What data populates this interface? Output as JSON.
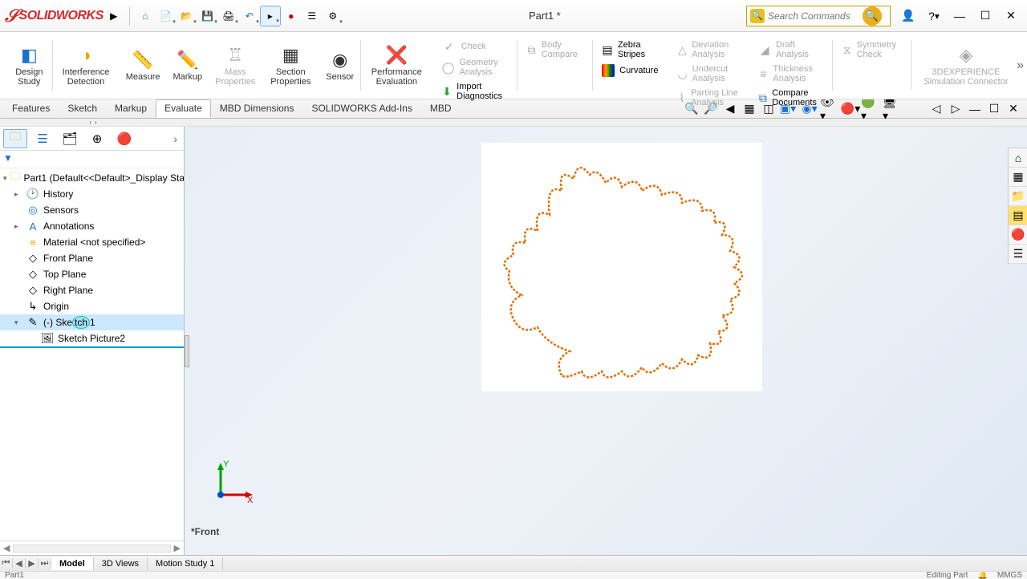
{
  "title": "Part1 *",
  "search_placeholder": "Search Commands",
  "quick_access": [
    "home",
    "new",
    "open",
    "save",
    "print",
    "undo",
    "select",
    "rec",
    "options",
    "gear"
  ],
  "ribbon": {
    "design_study": "Design Study",
    "interference": "Interference Detection",
    "measure": "Measure",
    "markup": "Markup",
    "mass_props": "Mass Properties",
    "section_props": "Section Properties",
    "sensor": "Sensor",
    "perf_eval": "Performance Evaluation",
    "check": "Check",
    "geom_analysis": "Geometry Analysis",
    "import_diag": "Import Diagnostics",
    "body_compare": "Body Compare",
    "zebra": "Zebra Stripes",
    "curvature": "Curvature",
    "deviation": "Deviation Analysis",
    "undercut": "Undercut Analysis",
    "parting": "Parting Line Analysis",
    "draft": "Draft Analysis",
    "thickness": "Thickness Analysis",
    "compare_docs": "Compare Documents",
    "symmetry": "Symmetry Check",
    "exp_sim": "3DEXPERIENCE Simulation Connector"
  },
  "tabs": [
    "Features",
    "Sketch",
    "Markup",
    "Evaluate",
    "MBD Dimensions",
    "SOLIDWORKS Add-Ins",
    "MBD"
  ],
  "active_tab": "Evaluate",
  "tree": {
    "root": "Part1  (Default<<Default>_Display Sta",
    "items": [
      {
        "label": "History",
        "icon": "📁"
      },
      {
        "label": "Sensors",
        "icon": "◎"
      },
      {
        "label": "Annotations",
        "icon": "📝"
      },
      {
        "label": "Material <not specified>",
        "icon": "≡"
      },
      {
        "label": "Front Plane",
        "icon": "◇"
      },
      {
        "label": "Top Plane",
        "icon": "◇"
      },
      {
        "label": "Right Plane",
        "icon": "◇"
      },
      {
        "label": "Origin",
        "icon": "↗"
      }
    ],
    "sketch_item": "(-) Sketch1",
    "child": "Sketch Picture2"
  },
  "view_label": "*Front",
  "triad": {
    "x": "X",
    "y": "Y"
  },
  "bottom_tabs": [
    "Model",
    "3D Views",
    "Motion Study 1"
  ],
  "status": {
    "left": "Part1",
    "editing": "Editing Part",
    "units": "MMGS"
  }
}
